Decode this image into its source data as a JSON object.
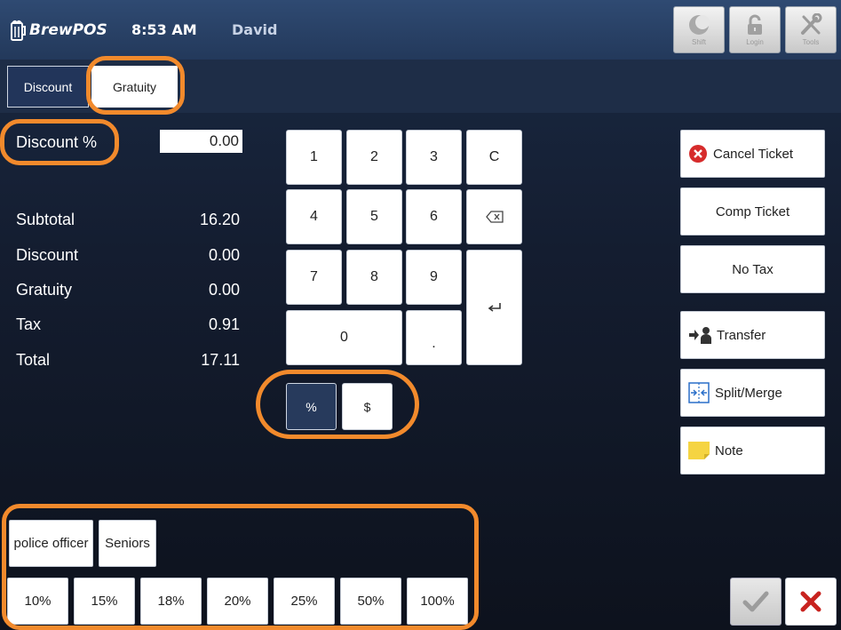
{
  "header": {
    "app_name": "BrewPOS",
    "time": "8:53 AM",
    "user": "David",
    "buttons": [
      {
        "label": "Shift",
        "icon": "moon-icon"
      },
      {
        "label": "Login",
        "icon": "unlock-icon"
      },
      {
        "label": "Tools",
        "icon": "tools-icon"
      }
    ]
  },
  "tabs": {
    "discount": "Discount",
    "gratuity": "Gratuity",
    "active": "Gratuity"
  },
  "entry": {
    "label": "Discount %",
    "value": "0.00"
  },
  "summary": [
    {
      "label": "Subtotal",
      "value": "16.20"
    },
    {
      "label": "Discount",
      "value": "0.00"
    },
    {
      "label": "Gratuity",
      "value": "0.00"
    },
    {
      "label": "Tax",
      "value": "0.91"
    },
    {
      "label": "Total",
      "value": "17.11"
    }
  ],
  "keypad": {
    "k1": "1",
    "k2": "2",
    "k3": "3",
    "clear": "C",
    "k4": "4",
    "k5": "5",
    "k6": "6",
    "k7": "7",
    "k8": "8",
    "k9": "9",
    "k0": "0",
    "dot": "."
  },
  "mode": {
    "percent": "%",
    "dollar": "$",
    "selected": "%"
  },
  "actions": {
    "cancel": "Cancel Ticket",
    "comp": "Comp Ticket",
    "notax": "No Tax",
    "transfer": "Transfer",
    "split": "Split/Merge",
    "note": "Note"
  },
  "presets": {
    "named": [
      "police officer",
      "Seniors"
    ],
    "percents": [
      "10%",
      "15%",
      "18%",
      "20%",
      "25%",
      "50%",
      "100%"
    ]
  },
  "colors": {
    "highlight_ring": "#f28a2c",
    "header_bg": "#2f4a72",
    "cancel_red": "#d62b2b",
    "note_yellow": "#f5d442"
  }
}
